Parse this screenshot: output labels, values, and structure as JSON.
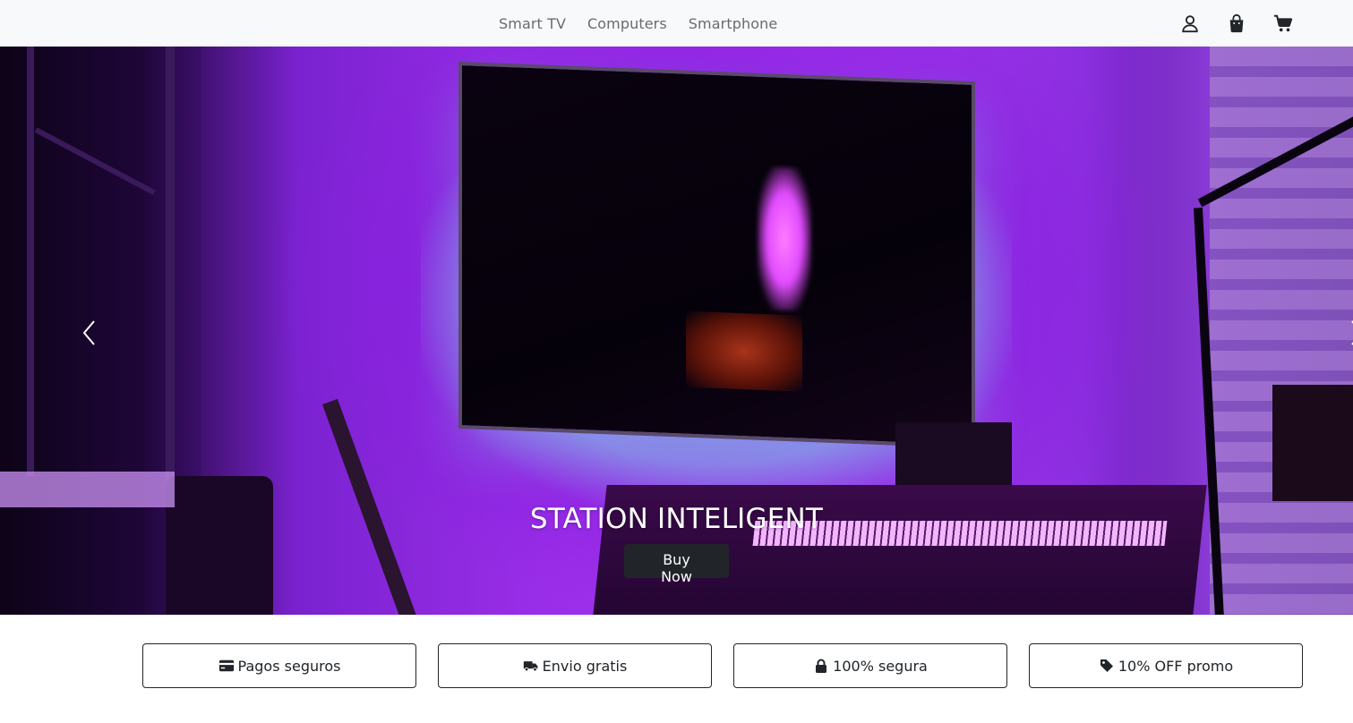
{
  "nav": {
    "links": [
      "Smart TV",
      "Computers",
      "Smartphone"
    ],
    "icons": [
      "user-icon",
      "shopping-bag-icon",
      "cart-icon"
    ]
  },
  "hero": {
    "title": "STATION INTELIGENT",
    "button_label": "Buy Now",
    "prev_icon": "chevron-left-icon",
    "next_icon": "chevron-right-icon"
  },
  "features": [
    {
      "icon": "credit-card-icon",
      "label": "Pagos seguros"
    },
    {
      "icon": "truck-icon",
      "label": "Envio gratis"
    },
    {
      "icon": "lock-icon",
      "label": "100% segura"
    },
    {
      "icon": "tag-icon",
      "label": "10% OFF promo"
    }
  ],
  "colors": {
    "navbar_bg": "#f8f9fa",
    "nav_text": "#6b6b6b",
    "button_bg": "#212529",
    "hero_accent": "#9a2ee8"
  }
}
